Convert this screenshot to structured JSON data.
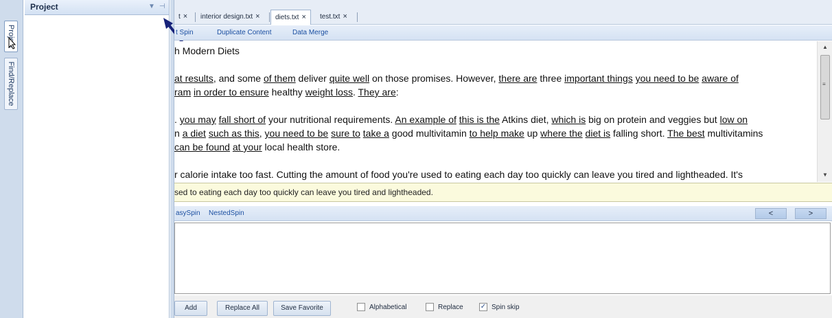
{
  "side_tabs": {
    "project": "Project",
    "find_replace": "Find/Replace"
  },
  "project_panel": {
    "title": "Project",
    "menu_glyph": "▼",
    "pin_glyph": "⊣"
  },
  "doc_tabs": [
    {
      "label": "t",
      "close": "×"
    },
    {
      "label": "interior design.txt",
      "close": "×"
    },
    {
      "label": "diets.txt",
      "close": "×",
      "active": true
    },
    {
      "label": "test.txt",
      "close": "×"
    }
  ],
  "toolbar": {
    "item1": "t Spin",
    "item2": "Duplicate Content",
    "item3": "Data Merge"
  },
  "editor": {
    "line1": "h Modern Diets",
    "line3_a": "at results",
    "line3_b": ", and some ",
    "line3_c": "of them",
    "line3_d": " deliver ",
    "line3_e": "quite well",
    "line3_f": " on those promises. However, ",
    "line3_g": "there are",
    "line3_h": " three ",
    "line3_i": "important things",
    "line3_j": " ",
    "line3_k": "you need to be",
    "line3_l": " ",
    "line3_m": "aware of",
    "line4_a": "ram",
    "line4_b": " ",
    "line4_c": "in order to ensure",
    "line4_d": " healthy ",
    "line4_e": "weight loss",
    "line4_f": ". ",
    "line4_g": "They are",
    "line4_h": ":",
    "line6_a": ". ",
    "line6_b": "you may",
    "line6_c": " ",
    "line6_d": "fall short of",
    "line6_e": " your nutritional requirements. ",
    "line6_f": "An example of",
    "line6_g": " ",
    "line6_h": "this is the",
    "line6_i": " Atkins diet, ",
    "line6_j": "which is",
    "line6_k": " big on protein and veggies but ",
    "line6_l": "low on",
    "line7_a": "n ",
    "line7_b": "a diet",
    "line7_c": " ",
    "line7_d": "such as this",
    "line7_e": ", ",
    "line7_f": "you need to be",
    "line7_g": " ",
    "line7_h": "sure to",
    "line7_i": " ",
    "line7_j": "take a",
    "line7_k": " good multivitamin ",
    "line7_l": "to help make",
    "line7_m": " up ",
    "line7_n": "where the",
    "line7_o": " ",
    "line7_p": "diet is",
    "line7_q": " falling short. ",
    "line7_r": "The best",
    "line7_s": " multivitamins",
    "line8_a": "can be found",
    "line8_b": " ",
    "line8_c": "at your",
    "line8_d": " local health store.",
    "line10": "r calorie intake too fast. Cutting the amount of food you're used to eating each day too quickly can leave you tired and lightheaded. It's"
  },
  "sentence_bar": {
    "text": "sed to eating each day too quickly can leave you tired and lightheaded."
  },
  "spin_toolbar": {
    "item1": "asySpin",
    "item2": "NestedSpin",
    "prev": "<",
    "next": ">"
  },
  "bottom": {
    "add": "Add",
    "replace_all": "Replace All",
    "save_favorite": "Save Favorite",
    "alphabetical": {
      "label": "Alphabetical",
      "checked": false
    },
    "replace": {
      "label": "Replace",
      "checked": false
    },
    "spin_skip": {
      "label": "Spin skip",
      "checked": true,
      "mark": "✓"
    }
  },
  "scroll": {
    "up": "▲",
    "down": "▼",
    "grip": "≡"
  }
}
